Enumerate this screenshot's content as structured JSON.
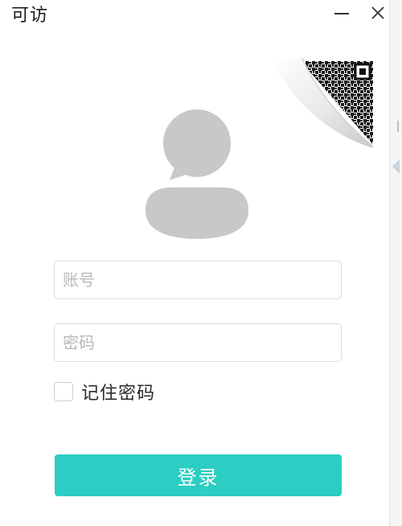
{
  "window": {
    "title": "可访"
  },
  "form": {
    "account_placeholder": "账号",
    "password_placeholder": "密码",
    "remember_label": "记住密码",
    "login_label": "登录"
  },
  "icons": {
    "minimize": "minimize-icon",
    "close": "close-icon",
    "qr": "qr-code-icon",
    "avatar": "user-avatar-icon"
  },
  "colors": {
    "accent": "#2ccdc2",
    "avatar_gray": "#c8c8c8",
    "input_border": "#dcdcdc",
    "placeholder": "#b8b8b8"
  }
}
